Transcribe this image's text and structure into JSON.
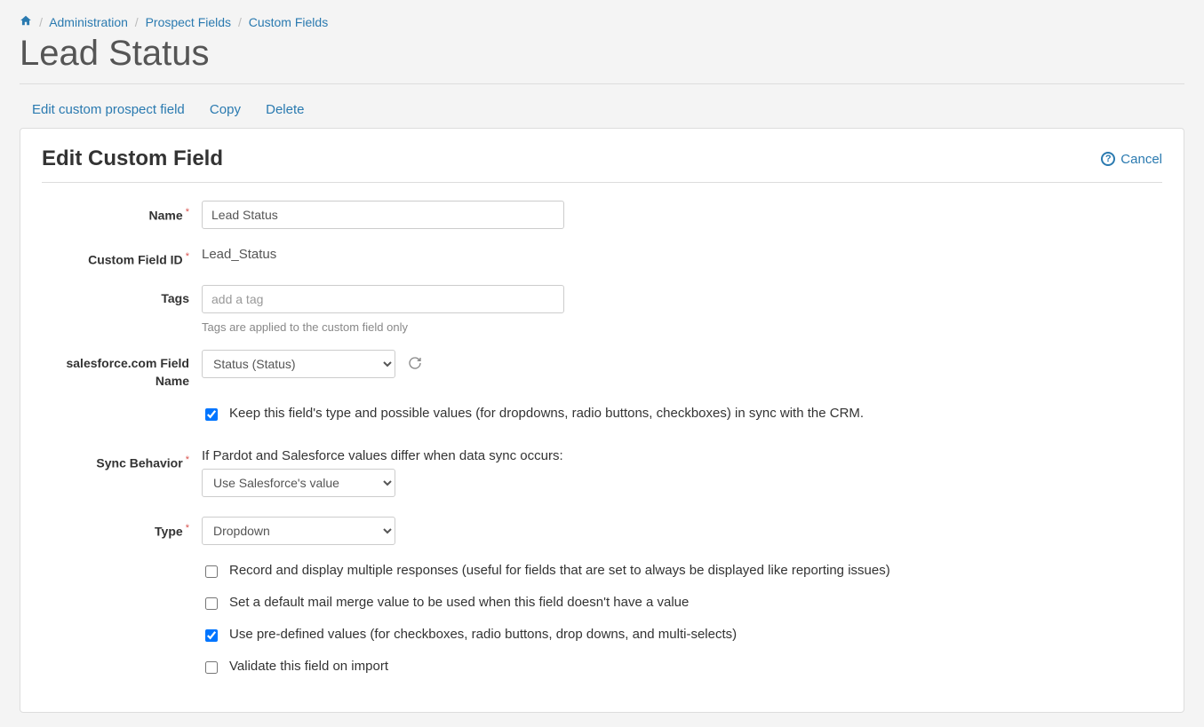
{
  "breadcrumb": {
    "admin": "Administration",
    "prospect_fields": "Prospect Fields",
    "custom_fields": "Custom Fields"
  },
  "page_title": "Lead Status",
  "tabs": {
    "edit": "Edit custom prospect field",
    "copy": "Copy",
    "delete": "Delete"
  },
  "panel": {
    "heading": "Edit Custom Field",
    "cancel": "Cancel"
  },
  "form": {
    "labels": {
      "name": "Name",
      "custom_field_id": "Custom Field ID",
      "tags": "Tags",
      "sf_field_name": "salesforce.com Field Name",
      "sync_behavior": "Sync Behavior",
      "type": "Type"
    },
    "name_value": "Lead Status",
    "custom_field_id_value": "Lead_Status",
    "tags_placeholder": "add a tag",
    "tags_helper": "Tags are applied to the custom field only",
    "sf_field_value": "Status (Status)",
    "sync_keep_label": "Keep this field's type and possible values (for dropdowns, radio buttons, checkboxes) in sync with the CRM.",
    "sync_prompt": "If Pardot and Salesforce values differ when data sync occurs:",
    "sync_behavior_value": "Use Salesforce's value",
    "type_value": "Dropdown",
    "checkboxes": {
      "record_multiple": "Record and display multiple responses (useful for fields that are set to always be displayed like reporting issues)",
      "default_merge": "Set a default mail merge value to be used when this field doesn't have a value",
      "predefined": "Use pre-defined values (for checkboxes, radio buttons, drop downs, and multi-selects)",
      "validate": "Validate this field on import"
    }
  }
}
